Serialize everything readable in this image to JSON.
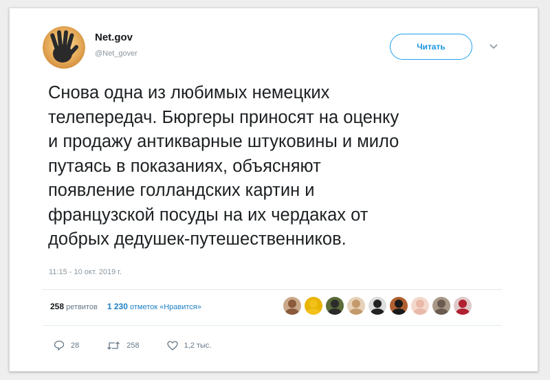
{
  "user": {
    "name": "Net.gov",
    "handle": "@Net_gover",
    "follow_label": "Читать"
  },
  "tweet": {
    "text": "Снова одна из любимых немецких\nтелепередач. Бюргеры приносят на оценку\nи продажу антикварные штуковины и мило\nпутаясь в показаниях, объясняют\nпоявление голландских картин и\nфранцузской посуды на их чердаках от\nдобрых дедушек-путешественников.",
    "timestamp": "11:15 - 10 окт. 2019 г."
  },
  "stats": {
    "retweets_count": "258",
    "retweets_label": "ретвитов",
    "likes_count": "1 230",
    "likes_label": "отметок «Нравится»"
  },
  "liker_avatars": [
    {
      "color": "#8a5a3a",
      "bg": "#c9a98a"
    },
    {
      "color": "#f2c21b",
      "bg": "#e8b400"
    },
    {
      "color": "#2b2b2b",
      "bg": "#5b6b3a"
    },
    {
      "color": "#c49a6c",
      "bg": "#e6d2b8"
    },
    {
      "color": "#222222",
      "bg": "#dddddd"
    },
    {
      "color": "#1a1a1a",
      "bg": "#b06030"
    },
    {
      "color": "#e8b8a8",
      "bg": "#f4d8cc"
    },
    {
      "color": "#6a5a50",
      "bg": "#a89888"
    },
    {
      "color": "#b02030",
      "bg": "#e0c8c8"
    }
  ],
  "actions": {
    "reply_count": "28",
    "retweet_count": "258",
    "like_count": "1,2 тыс."
  },
  "colors": {
    "accent": "#1da1f2",
    "text": "#1c2022",
    "muted": "#8a959e"
  }
}
